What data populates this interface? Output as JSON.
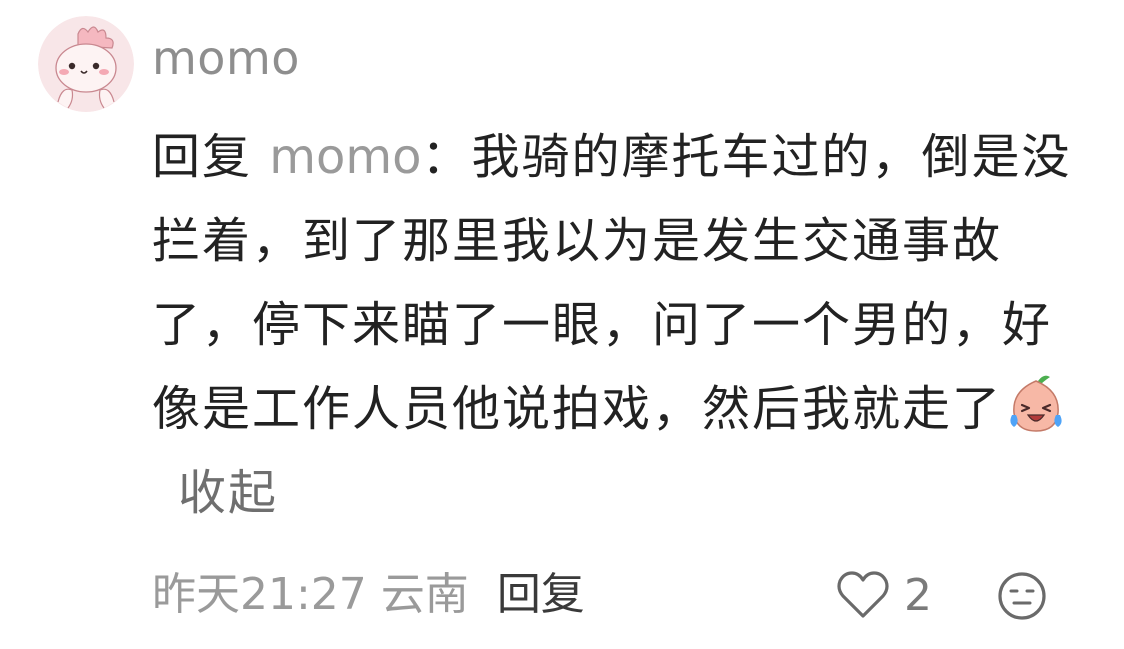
{
  "user": {
    "name": "momo",
    "avatar_icon": "pink-cartoon-avatar-icon"
  },
  "comment": {
    "reply_label": "回复",
    "reply_target": "momo",
    "colon": "：",
    "text": "我骑的摩托车过的，倒是没拦着，到了那里我以为是发生交通事故了，停下来瞄了一眼，问了一个男的，好像是工作人员他说拍戏，然后我就走了",
    "emoji": "crying-laughing-emoji",
    "collapse_label": "收起"
  },
  "meta": {
    "time": "昨天21:27",
    "location": "云南",
    "reply_button": "回复"
  },
  "actions": {
    "like_icon": "heart-outline-icon",
    "like_count": "2",
    "dislike_icon": "dislike-face-icon"
  },
  "colors": {
    "text": "#222222",
    "muted": "#9a9a9a",
    "avatar_bg": "#f8e6e8"
  }
}
